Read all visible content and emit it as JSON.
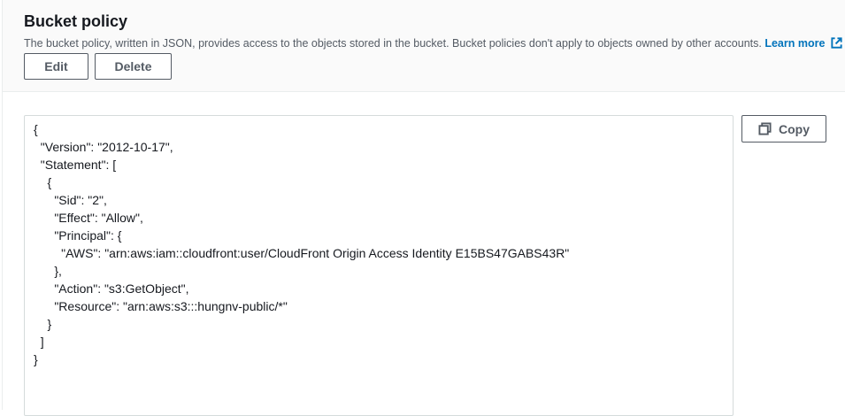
{
  "header": {
    "title": "Bucket policy",
    "description": "The bucket policy, written in JSON, provides access to the objects stored in the bucket. Bucket policies don't apply to objects owned by other accounts.",
    "learn_more": "Learn more"
  },
  "actions": {
    "edit_label": "Edit",
    "delete_label": "Delete",
    "copy_label": "Copy"
  },
  "icons": {
    "external_link": "external-link-icon",
    "copy": "copy-icon"
  },
  "colors": {
    "link": "#0073bb",
    "button_border": "#545b64",
    "header_bg": "#fafafa"
  },
  "policy_lines": [
    "{",
    "  \"Version\": \"2012-10-17\",",
    "  \"Statement\": [",
    "    {",
    "      \"Sid\": \"2\",",
    "      \"Effect\": \"Allow\",",
    "      \"Principal\": {",
    "        \"AWS\": \"arn:aws:iam::cloudfront:user/CloudFront Origin Access Identity E15BS47GABS43R\"",
    "      },",
    "      \"Action\": \"s3:GetObject\",",
    "      \"Resource\": \"arn:aws:s3:::hungnv-public/*\"",
    "    }",
    "  ]",
    "}"
  ]
}
